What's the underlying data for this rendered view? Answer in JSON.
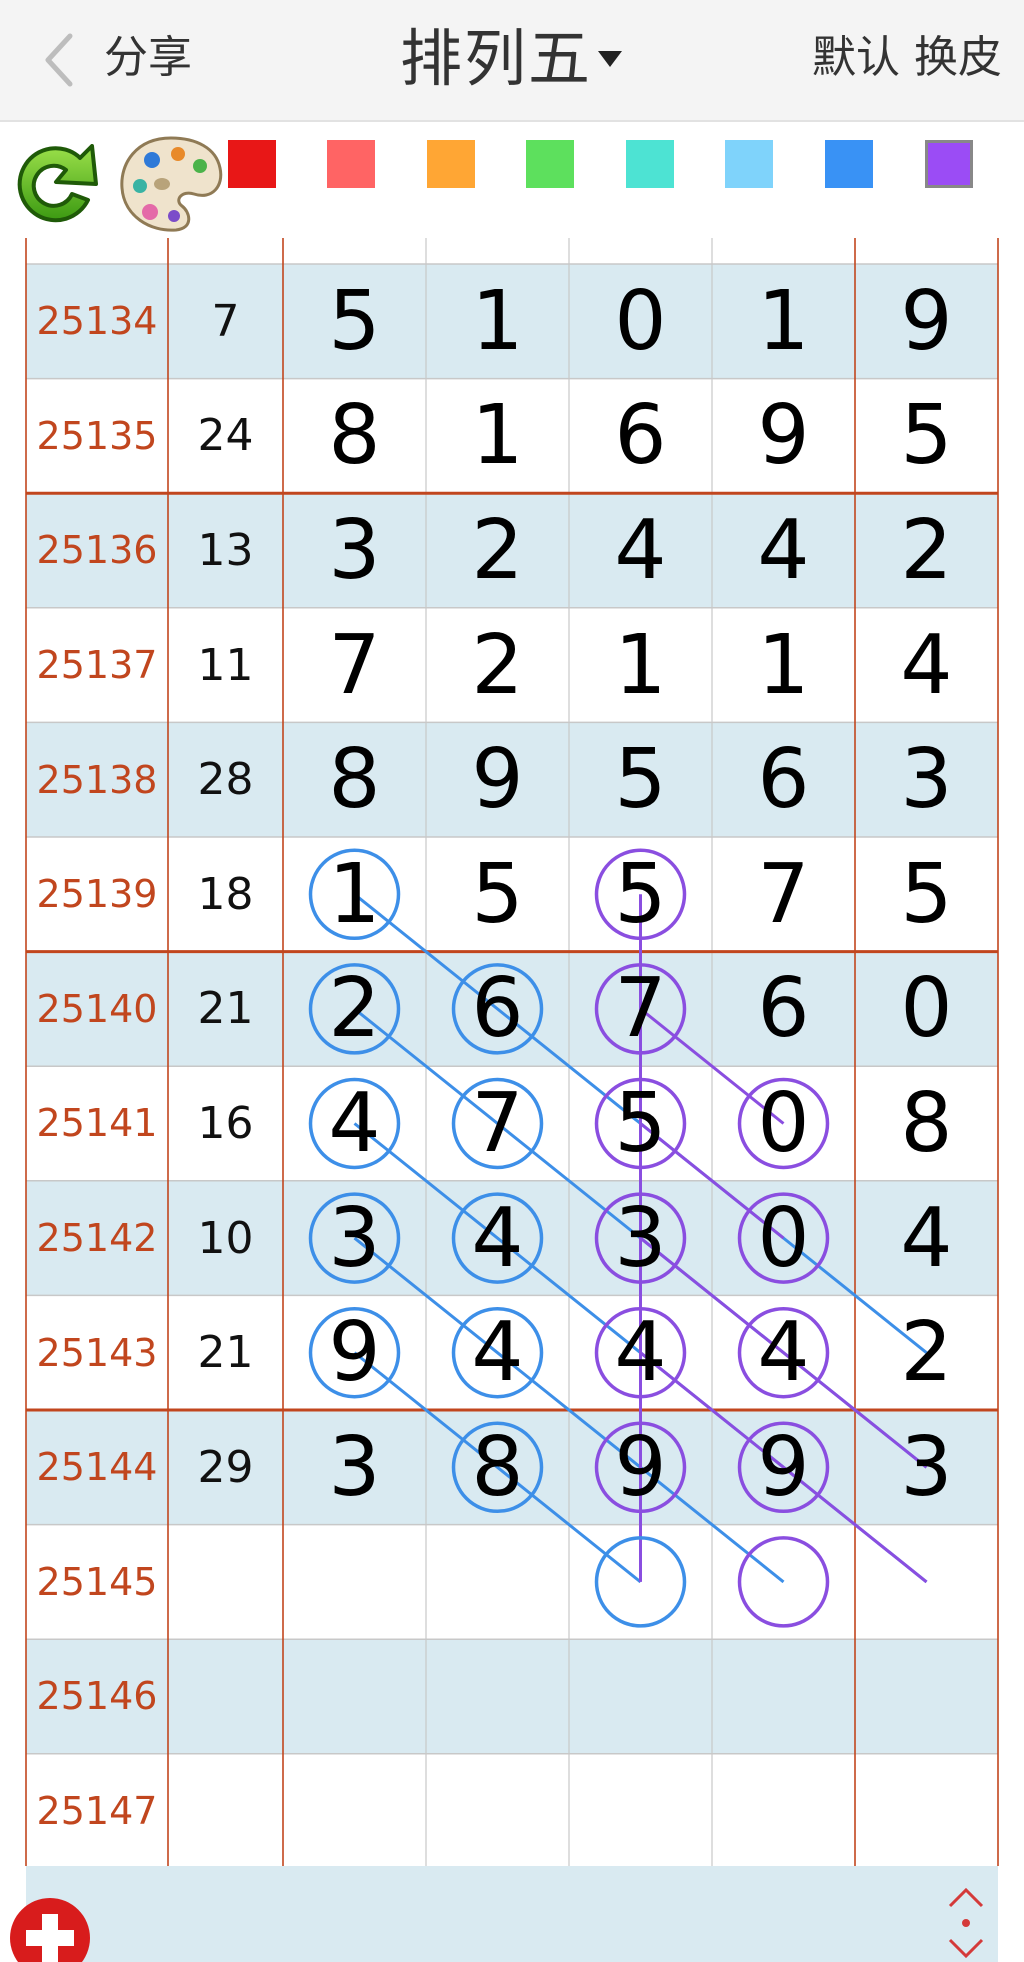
{
  "header": {
    "back_label": "",
    "share_label": "分享",
    "title": "排列五",
    "default_label": "默认",
    "skin_label": "换皮"
  },
  "toolbar": {
    "refresh_icon": "refresh-icon",
    "palette_icon": "palette-icon",
    "swatches": [
      "#e81717",
      "#ff6464",
      "#ffa634",
      "#5de05d",
      "#4de3d3",
      "#7fd3fb",
      "#3992f5",
      "#9b4cf5"
    ],
    "selected_swatch": 7
  },
  "table": {
    "rows": [
      {
        "period": "25134",
        "sum": "7",
        "digits": [
          "5",
          "1",
          "0",
          "1",
          "9"
        ]
      },
      {
        "period": "25135",
        "sum": "24",
        "digits": [
          "8",
          "1",
          "6",
          "9",
          "5"
        ]
      },
      {
        "period": "25136",
        "sum": "13",
        "digits": [
          "3",
          "2",
          "4",
          "4",
          "2"
        ]
      },
      {
        "period": "25137",
        "sum": "11",
        "digits": [
          "7",
          "2",
          "1",
          "1",
          "4"
        ]
      },
      {
        "period": "25138",
        "sum": "28",
        "digits": [
          "8",
          "9",
          "5",
          "6",
          "3"
        ]
      },
      {
        "period": "25139",
        "sum": "18",
        "digits": [
          "1",
          "5",
          "5",
          "7",
          "5"
        ]
      },
      {
        "period": "25140",
        "sum": "21",
        "digits": [
          "2",
          "6",
          "7",
          "6",
          "0"
        ]
      },
      {
        "period": "25141",
        "sum": "16",
        "digits": [
          "4",
          "7",
          "5",
          "0",
          "8"
        ]
      },
      {
        "period": "25142",
        "sum": "10",
        "digits": [
          "3",
          "4",
          "3",
          "0",
          "4"
        ]
      },
      {
        "period": "25143",
        "sum": "21",
        "digits": [
          "9",
          "4",
          "4",
          "4",
          "2"
        ]
      },
      {
        "period": "25144",
        "sum": "29",
        "digits": [
          "3",
          "8",
          "9",
          "9",
          "3"
        ]
      },
      {
        "period": "25145",
        "sum": "",
        "digits": [
          "",
          "",
          "",
          "",
          ""
        ]
      },
      {
        "period": "25146",
        "sum": "",
        "digits": [
          "",
          "",
          "",
          "",
          ""
        ]
      },
      {
        "period": "25147",
        "sum": "",
        "digits": [
          "",
          "",
          "",
          "",
          ""
        ]
      }
    ],
    "group_separator_after_rows": [
      1,
      5,
      9
    ],
    "colors": {
      "stripe": "#d9eaf1",
      "grid_line": "#c8c8c8",
      "separator": "#c1461e",
      "blue": "#3d8fe8",
      "purple": "#8a4ee0"
    },
    "marked_cells": [
      {
        "row": 5,
        "col": 0,
        "color": "blue"
      },
      {
        "row": 6,
        "col": 0,
        "color": "blue"
      },
      {
        "row": 7,
        "col": 0,
        "color": "blue"
      },
      {
        "row": 8,
        "col": 0,
        "color": "blue"
      },
      {
        "row": 9,
        "col": 0,
        "color": "blue"
      },
      {
        "row": 6,
        "col": 1,
        "color": "blue"
      },
      {
        "row": 7,
        "col": 1,
        "color": "blue"
      },
      {
        "row": 8,
        "col": 1,
        "color": "blue"
      },
      {
        "row": 9,
        "col": 1,
        "color": "blue"
      },
      {
        "row": 10,
        "col": 1,
        "color": "blue"
      },
      {
        "row": 11,
        "col": 2,
        "color": "blue"
      },
      {
        "row": 5,
        "col": 2,
        "color": "purple"
      },
      {
        "row": 6,
        "col": 2,
        "color": "purple"
      },
      {
        "row": 7,
        "col": 2,
        "color": "purple"
      },
      {
        "row": 8,
        "col": 2,
        "color": "purple"
      },
      {
        "row": 9,
        "col": 2,
        "color": "purple"
      },
      {
        "row": 10,
        "col": 2,
        "color": "purple"
      },
      {
        "row": 7,
        "col": 3,
        "color": "purple"
      },
      {
        "row": 8,
        "col": 3,
        "color": "purple"
      },
      {
        "row": 9,
        "col": 3,
        "color": "purple"
      },
      {
        "row": 10,
        "col": 3,
        "color": "purple"
      },
      {
        "row": 11,
        "col": 3,
        "color": "purple"
      }
    ],
    "trend_lines": [
      {
        "color": "blue",
        "from": [
          5,
          0
        ],
        "to": [
          9,
          4
        ]
      },
      {
        "color": "blue",
        "from": [
          6,
          0
        ],
        "to": [
          10,
          4
        ]
      },
      {
        "color": "blue",
        "from": [
          7,
          0
        ],
        "to": [
          11,
          4
        ]
      },
      {
        "color": "blue",
        "from": [
          8,
          0
        ],
        "to": [
          11,
          3
        ]
      },
      {
        "color": "blue",
        "from": [
          9,
          0
        ],
        "to": [
          11,
          2
        ]
      },
      {
        "color": "purple",
        "from": [
          5,
          2
        ],
        "to": [
          11,
          2
        ]
      },
      {
        "color": "purple",
        "from": [
          6,
          2
        ],
        "to": [
          7,
          3
        ]
      },
      {
        "color": "purple",
        "from": [
          7,
          2
        ],
        "to": [
          8,
          3
        ]
      },
      {
        "color": "purple",
        "from": [
          8,
          2
        ],
        "to": [
          10,
          4
        ]
      },
      {
        "color": "purple",
        "from": [
          9,
          2
        ],
        "to": [
          11,
          4
        ]
      }
    ]
  },
  "footer": {
    "add_icon": "add-icon",
    "expand_icon": "expand-collapse-icon"
  }
}
